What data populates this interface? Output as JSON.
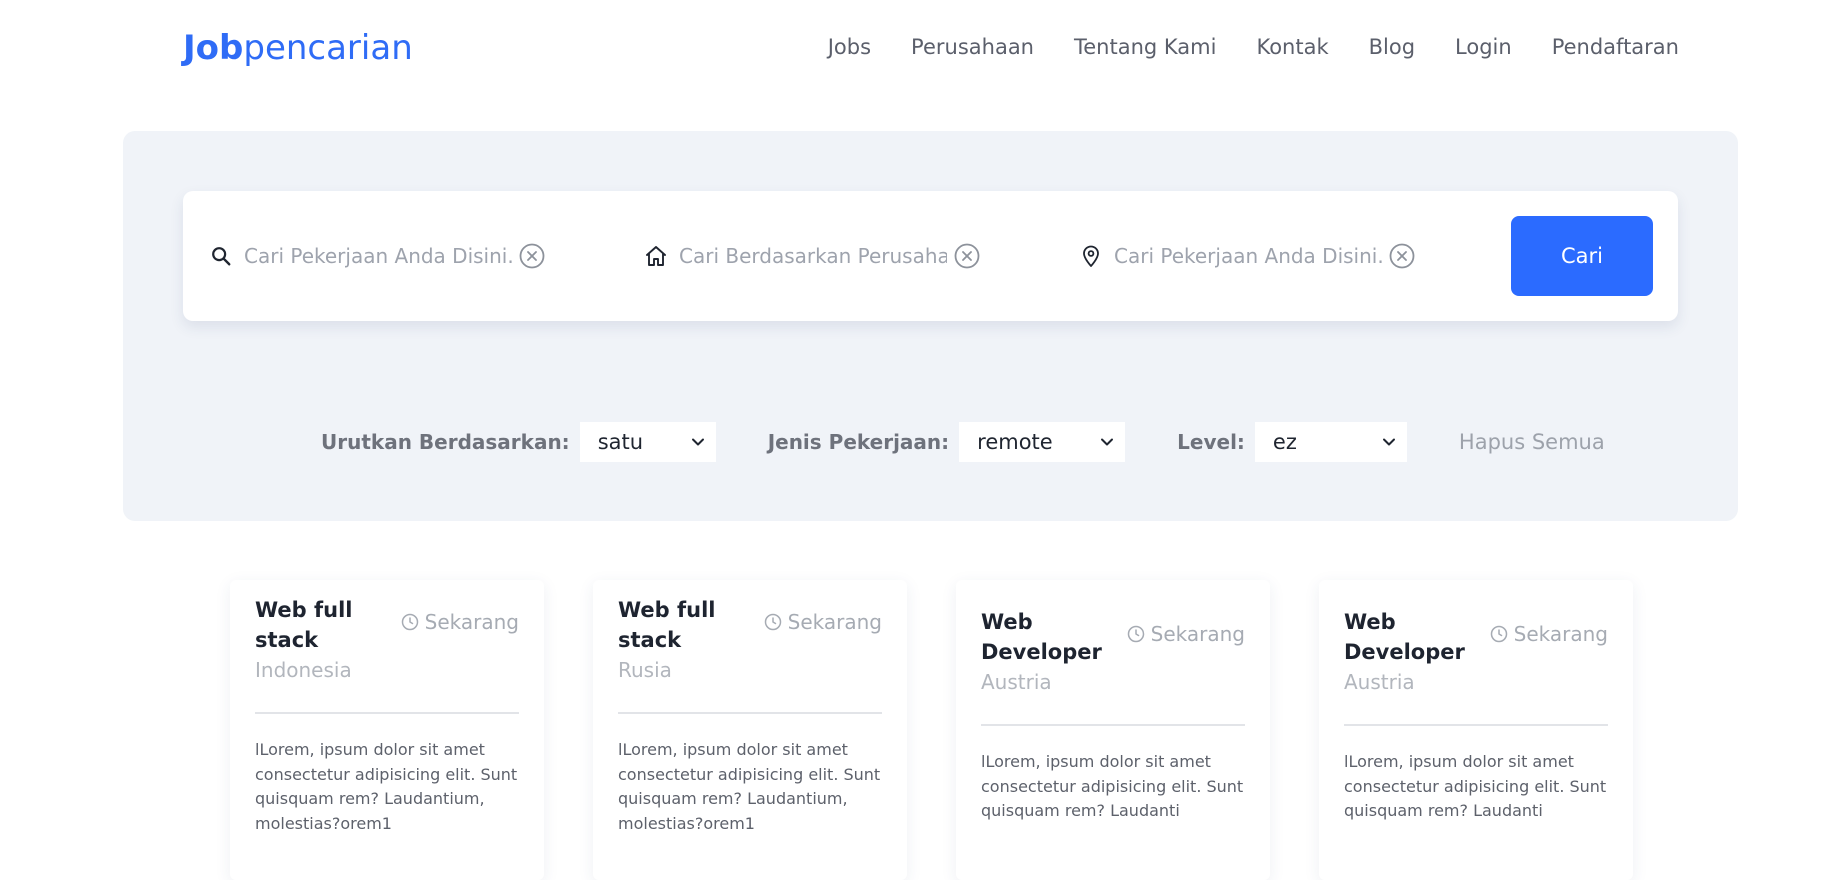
{
  "brand": {
    "logo_bold": "Job",
    "logo_regular": "pencarian",
    "color": "#2f6cf6"
  },
  "nav": {
    "links": [
      "Jobs",
      "Perusahaan",
      "Tentang Kami",
      "Kontak",
      "Blog",
      "Login",
      "Pendaftaran"
    ]
  },
  "search": {
    "job_placeholder": "Cari Pekerjaan Anda Disini...",
    "company_placeholder": "Cari Berdasarkan Perusahaan",
    "location_placeholder": "Cari Pekerjaan Anda Disini...",
    "button_label": "Cari",
    "button_color": "#2b6bff"
  },
  "filters": {
    "sort_label": "Urutkan Berdasarkan:",
    "sort_value": "satu",
    "type_label": "Jenis Pekerjaan:",
    "type_value": "remote",
    "level_label": "Level:",
    "level_value": "ez",
    "clear_label": "Hapus Semua"
  },
  "jobs": [
    {
      "title": "Web full stack",
      "time": "Sekarang",
      "location": "Indonesia",
      "description": "lLorem, ipsum dolor sit amet consectetur adipisicing elit. Sunt quisquam rem? Laudantium, molestias?orem1"
    },
    {
      "title": "Web full stack",
      "time": "Sekarang",
      "location": "Rusia",
      "description": "lLorem, ipsum dolor sit amet consectetur adipisicing elit. Sunt quisquam rem? Laudantium, molestias?orem1"
    },
    {
      "title": "Web Developer",
      "time": "Sekarang",
      "location": "Austria",
      "description": "lLorem, ipsum dolor sit amet consectetur adipisicing elit. Sunt quisquam rem? Laudanti"
    },
    {
      "title": "Web Developer",
      "time": "Sekarang",
      "location": "Austria",
      "description": "lLorem, ipsum dolor sit amet consectetur adipisicing elit. Sunt quisquam rem? Laudanti"
    }
  ]
}
